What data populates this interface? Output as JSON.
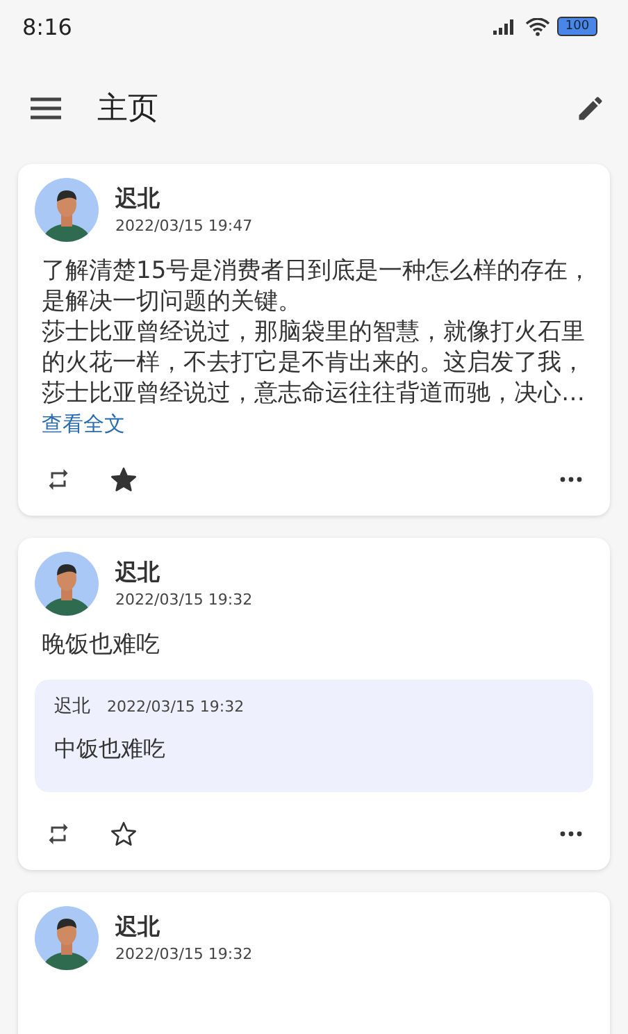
{
  "status_bar": {
    "time": "8:16",
    "battery": "100"
  },
  "app_bar": {
    "title": "主页"
  },
  "posts": [
    {
      "author": "迟北",
      "time": "2022/03/15 19:47",
      "paragraphs": [
        "了解清楚15号是消费者日到底是一种怎么样的存在，是解决一切问题的关键。",
        "莎士比亚曾经说过，那脑袋里的智慧，就像打火石里的火花一样，不去打它是不肯出来的。这启发了我，莎士比亚曾经说过，意志命运往往背道而驰，决心…"
      ],
      "more_link": "查看全文",
      "starred": true
    },
    {
      "author": "迟北",
      "time": "2022/03/15 19:32",
      "paragraphs": [
        "晚饭也难吃"
      ],
      "quote": {
        "author": "迟北",
        "time": "2022/03/15 19:32",
        "text": "中饭也难吃"
      },
      "starred": false
    },
    {
      "author": "迟北",
      "time": "2022/03/15 19:32"
    }
  ]
}
